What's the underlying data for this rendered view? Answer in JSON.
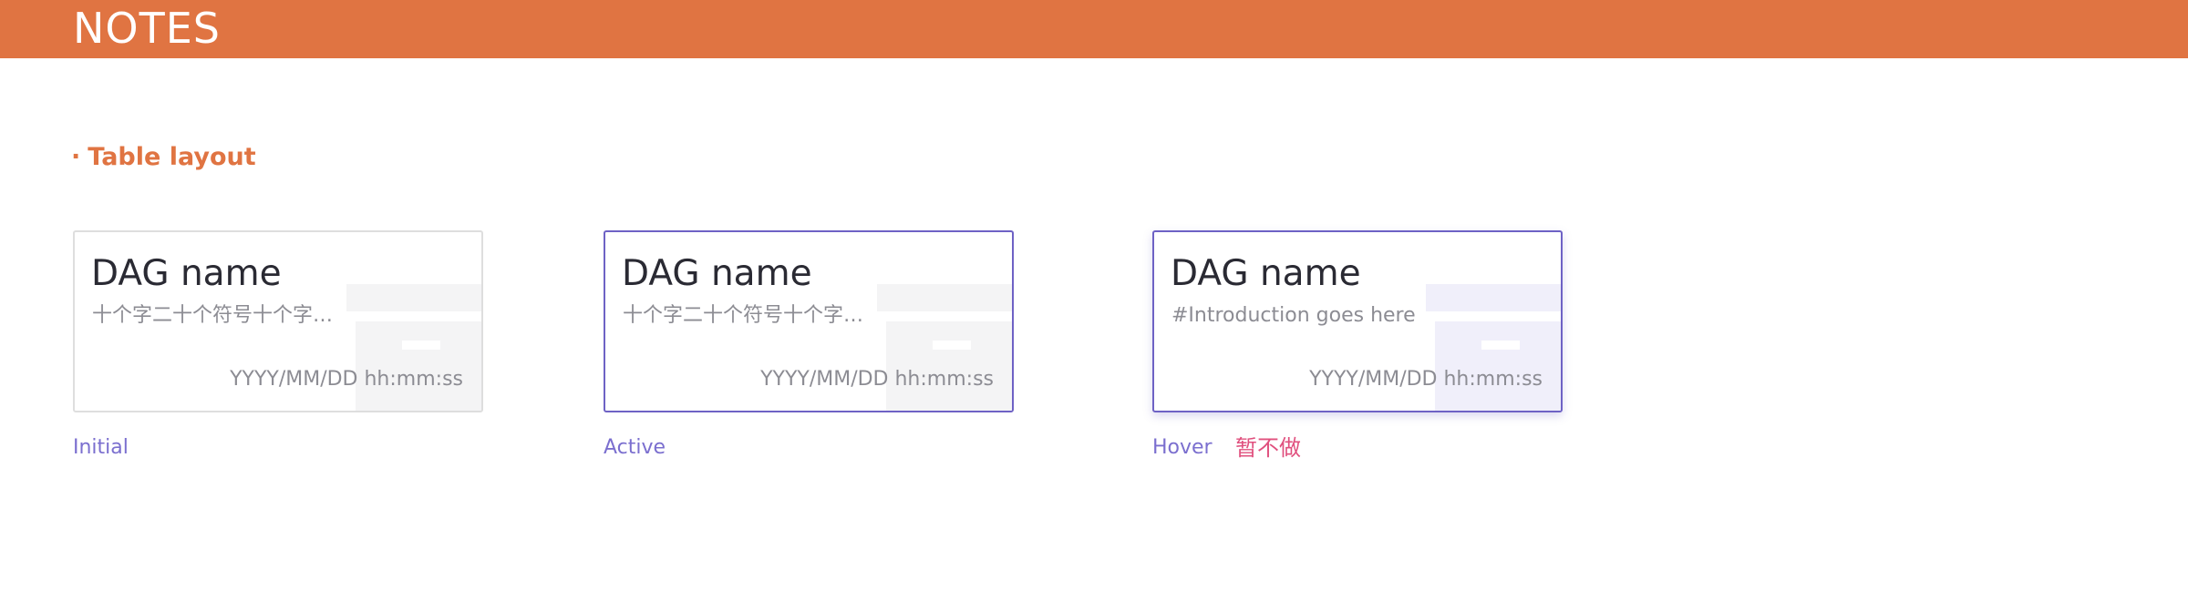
{
  "header": {
    "title": "NOTES"
  },
  "section": {
    "bullet": "·",
    "title": "Table layout"
  },
  "cards": [
    {
      "state": "Initial",
      "name": "DAG name",
      "description": "十个字二十个符号十个字二十个符号",
      "timestamp": "YYYY/MM/DD hh:mm:ss"
    },
    {
      "state": "Active",
      "name": "DAG name",
      "description": "十个字二十个符号十个字二十个符号",
      "timestamp": "YYYY/MM/DD hh:mm:ss"
    },
    {
      "state": "Hover",
      "note": "暂不做",
      "name": "DAG name",
      "description": "#Introduction goes here",
      "timestamp": "YYYY/MM/DD hh:mm:ss"
    }
  ],
  "colors": {
    "brand": "#E07442",
    "accent": "#6E62C5",
    "state_label": "#7B6FCF",
    "note": "#E0507E"
  }
}
